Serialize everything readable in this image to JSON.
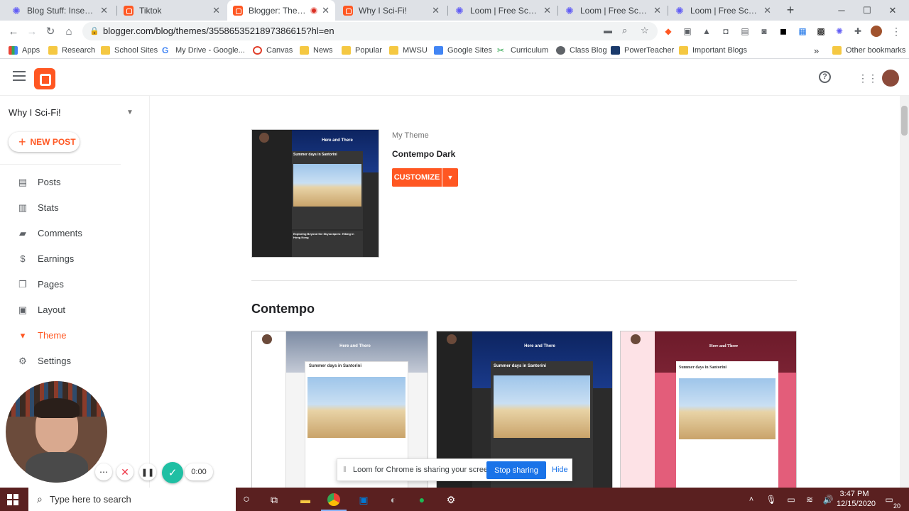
{
  "browser": {
    "tabs": [
      {
        "title": "Blog Stuff: Inserting Im...",
        "icon": "loom-icon"
      },
      {
        "title": "Tiktok",
        "icon": "blogger-icon"
      },
      {
        "title": "Blogger: Theme",
        "icon": "blogger-icon",
        "active": true
      },
      {
        "title": "Why I Sci-Fi!",
        "icon": "blogger-icon"
      },
      {
        "title": "Loom | Free Screen & V",
        "icon": "loom-icon"
      },
      {
        "title": "Loom | Free Screen & V",
        "icon": "loom-icon"
      },
      {
        "title": "Loom | Free Screen & V",
        "icon": "loom-icon"
      }
    ],
    "url": "blogger.com/blog/themes/3558653521897386615?hl=en",
    "bookmarks": [
      {
        "label": "Apps",
        "icon": "apps-icon"
      },
      {
        "label": "Research",
        "icon": "folder-icon"
      },
      {
        "label": "School Sites",
        "icon": "folder-icon"
      },
      {
        "label": "My Drive - Google...",
        "icon": "google-icon"
      },
      {
        "label": "Canvas",
        "icon": "canvas-icon"
      },
      {
        "label": "News",
        "icon": "folder-icon"
      },
      {
        "label": "Popular",
        "icon": "folder-icon"
      },
      {
        "label": "MWSU",
        "icon": "folder-icon"
      },
      {
        "label": "Google Sites",
        "icon": "sites-icon"
      },
      {
        "label": "Curriculum",
        "icon": "curriculum-icon"
      },
      {
        "label": "Class Blog",
        "icon": "globe-icon"
      },
      {
        "label": "PowerTeacher",
        "icon": "sis-icon"
      },
      {
        "label": "Important Blogs",
        "icon": "folder-icon"
      }
    ],
    "overflow": "»",
    "other_bookmarks": "Other bookmarks",
    "new_tab": "+"
  },
  "blogger": {
    "blog_name": "Why I Sci-Fi!",
    "new_post": "NEW POST",
    "nav": [
      {
        "label": "Posts",
        "icon": "posts-icon"
      },
      {
        "label": "Stats",
        "icon": "stats-icon"
      },
      {
        "label": "Comments",
        "icon": "comments-icon"
      },
      {
        "label": "Earnings",
        "icon": "dollar-icon"
      },
      {
        "label": "Pages",
        "icon": "pages-icon"
      },
      {
        "label": "Layout",
        "icon": "layout-icon"
      },
      {
        "label": "Theme",
        "icon": "theme-icon",
        "active": true
      },
      {
        "label": "Settings",
        "icon": "gear-icon"
      }
    ],
    "my_theme_label": "My Theme",
    "my_theme_name": "Contempo Dark",
    "customize": "CUSTOMIZE",
    "section_title": "Contempo",
    "preview_heading": "Here and There",
    "preview_post": "Summer days in Santorini",
    "preview_post2": "Exploring Beyond the Skyscrapers: Hiking in Hong Kong",
    "accent": "#ff5722"
  },
  "loom": {
    "timer": "0:00",
    "sharing_text": "Loom for Chrome is sharing your screen.",
    "stop_sharing": "Stop sharing",
    "hide": "Hide"
  },
  "taskbar": {
    "search_placeholder": "Type here to search",
    "time": "3:47 PM",
    "date": "12/15/2020",
    "notifications": "20"
  }
}
